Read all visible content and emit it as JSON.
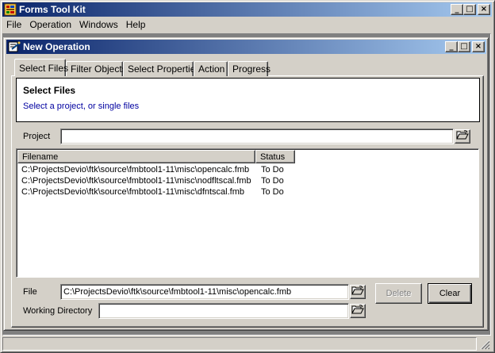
{
  "app": {
    "title": "Forms Tool Kit",
    "controls": {
      "minimize": "_",
      "maximize": "□",
      "close": "×"
    }
  },
  "menu": {
    "items": [
      {
        "label": "File"
      },
      {
        "label": "Operation"
      },
      {
        "label": "Windows"
      },
      {
        "label": "Help"
      }
    ]
  },
  "child": {
    "title": "New Operation",
    "controls": {
      "minimize": "_",
      "maximize": "□",
      "close": "×"
    }
  },
  "tabs": [
    {
      "label": "Select Files",
      "active": true
    },
    {
      "label": "Filter Objects",
      "active": false
    },
    {
      "label": "Select Properties",
      "active": false
    },
    {
      "label": "Action",
      "active": false
    },
    {
      "label": "Progress",
      "active": false
    }
  ],
  "header": {
    "title": "Select Files",
    "subtitle": "Select a project, or single files"
  },
  "project": {
    "label": "Project",
    "value": ""
  },
  "file_list": {
    "columns": [
      {
        "label": "Filename"
      },
      {
        "label": "Status"
      }
    ],
    "rows": [
      {
        "filename": "C:\\ProjectsDevio\\ftk\\source\\fmbtool1-11\\misc\\opencalc.fmb",
        "status": "To Do"
      },
      {
        "filename": "C:\\ProjectsDevio\\ftk\\source\\fmbtool1-11\\misc\\nodfltscal.fmb",
        "status": "To Do"
      },
      {
        "filename": "C:\\ProjectsDevio\\ftk\\source\\fmbtool1-11\\misc\\dfntscal.fmb",
        "status": "To Do"
      }
    ]
  },
  "file": {
    "label": "File",
    "value": "C:\\ProjectsDevio\\ftk\\source\\fmbtool1-11\\misc\\opencalc.fmb"
  },
  "working_directory": {
    "label": "Working Directory",
    "value": ""
  },
  "buttons": {
    "delete": {
      "label": "Delete",
      "enabled": false
    },
    "clear": {
      "label": "Clear",
      "enabled": true
    }
  },
  "icons": {
    "app": "form-tools-icon",
    "child": "wizard-icon",
    "browse": "open-folder-icon"
  },
  "colors": {
    "titlebar_start": "#0a246a",
    "titlebar_end": "#a6caf0",
    "face": "#d4d0c8",
    "subtitle_text": "#0000a0"
  }
}
